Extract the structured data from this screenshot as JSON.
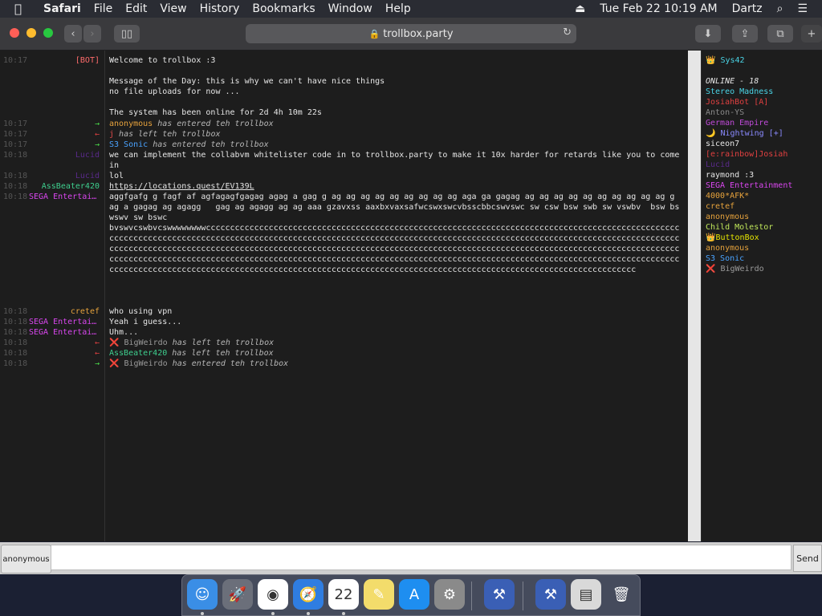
{
  "menubar": {
    "apple": "",
    "app": "Safari",
    "items": [
      "File",
      "Edit",
      "View",
      "History",
      "Bookmarks",
      "Window",
      "Help"
    ],
    "datetime": "Tue Feb 22  10:19 AM",
    "user": "Dartz"
  },
  "browser": {
    "url": "trollbox.party"
  },
  "chat": {
    "rows": [
      {
        "time": "10:17",
        "nick": "[BOT]",
        "nick_color": "#ff6b6b",
        "msg": "Welcome to trollbox :3\n\nMessage of the Day: this is why we can't have nice things\nno file uploads for now ...\n\nThe system has been online for 2d 4h 10m 22s",
        "style": "normal"
      },
      {
        "time": "10:17",
        "nick": "→",
        "nick_color": "#4ade4a",
        "who": "anonymous",
        "who_color": "#e6a23c",
        "msg": " has entered teh trollbox",
        "style": "italic"
      },
      {
        "time": "10:17",
        "nick": "←",
        "nick_color": "#e04040",
        "who": "j",
        "who_color": "#e04a4a",
        "msg": " has left teh trollbox",
        "style": "italic"
      },
      {
        "time": "10:17",
        "nick": "→",
        "nick_color": "#4ade4a",
        "who": "S3 Sonic",
        "who_color": "#4aa3ff",
        "msg": " has entered teh trollbox",
        "style": "italic"
      },
      {
        "time": "10:18",
        "nick": "Lucid",
        "nick_color": "#5a2a8a",
        "msg": "we can implement the collabvm whitelister code in to trollbox.party to make it 10x harder for retards like you to come in",
        "style": "normal"
      },
      {
        "time": "10:18",
        "nick": "Lucid",
        "nick_color": "#5a2a8a",
        "msg": "lol",
        "style": "normal"
      },
      {
        "time": "10:18",
        "nick": "AssBeater420",
        "nick_color": "#3ecf8e",
        "msg": "https://locations.quest/EV139L",
        "style": "link"
      },
      {
        "time": "10:18",
        "nick": "SEGA Entertainment",
        "nick_color": "#d946ef",
        "msg": "aggfgafg g fagf af agfagagfgagag agag a gag g ag ag ag ag ag ag ag ag ag aga ga gagag ag ag ag ag ag ag ag ag ag ag g ag a gagag ag agagg   gag ag agagg ag ag aaa gzavxss aaxbxvaxsafwcswxswcvbsscbbcswvswc sw csw bsw swb sw vswbv  bsw bswswv sw bswc\nbvswvcswbvcswwwwwwwwccccccccccccccccccccccccccccccccccccccccccccccccccccccccccccccccccccccccccccccccccccccccccccccccccccccccccccccccccccccccccccccccccccccccccccccccccccccccccccccccccccccccccccccccccccccccccccccccccccccccccccccccccccccccccccccccccccccccccccccccccccccccccccccccccccccccccccccccccccccccccccccccccccccccccccccccccccccccccccccccccccccccccccccccccccccccccccccccccccccccccccccccccccccccccccccccccccccccccccccccccccccccccccccccccccccccccccccccccccccccccccccccccccccccccccccccccccccccccccccccccccccccccccccccccccccccccccccccccccccccccccccccccccccccccccccccccccccccccccccccc",
        "style": "normal"
      },
      {
        "time": "10:18",
        "nick": "cretef",
        "nick_color": "#e6a23c",
        "msg": "who using vpn",
        "style": "normal"
      },
      {
        "time": "10:18",
        "nick": "SEGA Entertainment",
        "nick_color": "#d946ef",
        "msg": "Yeah i guess...",
        "style": "normal"
      },
      {
        "time": "10:18",
        "nick": "SEGA Entertainment",
        "nick_color": "#d946ef",
        "msg": "Uhm...",
        "style": "normal"
      },
      {
        "time": "10:18",
        "nick": "←",
        "nick_color": "#e04040",
        "who": "❌ BigWeirdo",
        "who_color": "#9a9a9a",
        "msg": " has left teh trollbox",
        "style": "italic"
      },
      {
        "time": "10:18",
        "nick": "←",
        "nick_color": "#e04040",
        "who": "AssBeater420",
        "who_color": "#3ecf8e",
        "msg": " has left teh trollbox",
        "style": "italic"
      },
      {
        "time": "10:18",
        "nick": "→",
        "nick_color": "#4ade4a",
        "who": "❌ BigWeirdo",
        "who_color": "#9a9a9a",
        "msg": " has entered teh trollbox",
        "style": "italic"
      }
    ]
  },
  "userlist": {
    "self": "👑 Sys42",
    "self_color": "#4ad4e6",
    "online": "ONLINE - 18",
    "users": [
      {
        "name": "Stereo Madness",
        "color": "#4ad4e6"
      },
      {
        "name": "JosiahBot [A]",
        "color": "#e04040"
      },
      {
        "name": "Anton-YS",
        "color": "#8a8a8a"
      },
      {
        "name": "German Empire",
        "color": "#c04ad9"
      },
      {
        "name": "🌙 Nightwing [+]",
        "color": "#8a8aff"
      },
      {
        "name": "siceon7",
        "color": "#e6e6e6"
      },
      {
        "name": "[e:rainbow]Josiah",
        "color": "#e04040"
      },
      {
        "name": "Lucid",
        "color": "#5a2a8a"
      },
      {
        "name": "raymond :3",
        "color": "#e6e6e6"
      },
      {
        "name": "SEGA Entertainment",
        "color": "#d946ef"
      },
      {
        "name": "4000*AFK*",
        "color": "#e6a23c"
      },
      {
        "name": "cretef",
        "color": "#e6a23c"
      },
      {
        "name": "anonymous",
        "color": "#e6a23c"
      },
      {
        "name": "Child Molestor",
        "color": "#bfe65a"
      },
      {
        "name": "👑ButtonBox",
        "color": "#e6e600"
      },
      {
        "name": "anonymous",
        "color": "#e6a23c"
      },
      {
        "name": "S3 Sonic",
        "color": "#4aa3ff"
      },
      {
        "name": "❌ BigWeirdo",
        "color": "#9a9a9a"
      }
    ]
  },
  "inputbar": {
    "nick_label": "anonymous",
    "send_label": "Send",
    "value": ""
  },
  "dock": {
    "items": [
      {
        "name": "finder",
        "glyph": "☺",
        "bg": "#3a8ee6",
        "running": true
      },
      {
        "name": "launchpad",
        "glyph": "🚀",
        "bg": "#6b6f7a",
        "running": false
      },
      {
        "name": "chrome",
        "glyph": "◉",
        "bg": "#ffffff",
        "running": true
      },
      {
        "name": "safari",
        "glyph": "🧭",
        "bg": "#2f7de1",
        "running": true
      },
      {
        "name": "calendar",
        "glyph": "22",
        "bg": "#ffffff",
        "running": true
      },
      {
        "name": "notes",
        "glyph": "✎",
        "bg": "#f3dc6b",
        "running": false
      },
      {
        "name": "app-store",
        "glyph": "A",
        "bg": "#1e8ef0",
        "running": false
      },
      {
        "name": "system-preferences",
        "glyph": "⚙",
        "bg": "#8a8a8a",
        "running": false
      },
      {
        "name": "xcode",
        "glyph": "⚒",
        "bg": "#3a5fb5",
        "running": false
      },
      {
        "name": "xcode-2",
        "glyph": "⚒",
        "bg": "#3a5fb5",
        "running": false
      },
      {
        "name": "preview",
        "glyph": "▤",
        "bg": "#d9d9d9",
        "running": false
      },
      {
        "name": "trash",
        "glyph": "🗑",
        "bg": "transparent",
        "running": false
      }
    ]
  }
}
